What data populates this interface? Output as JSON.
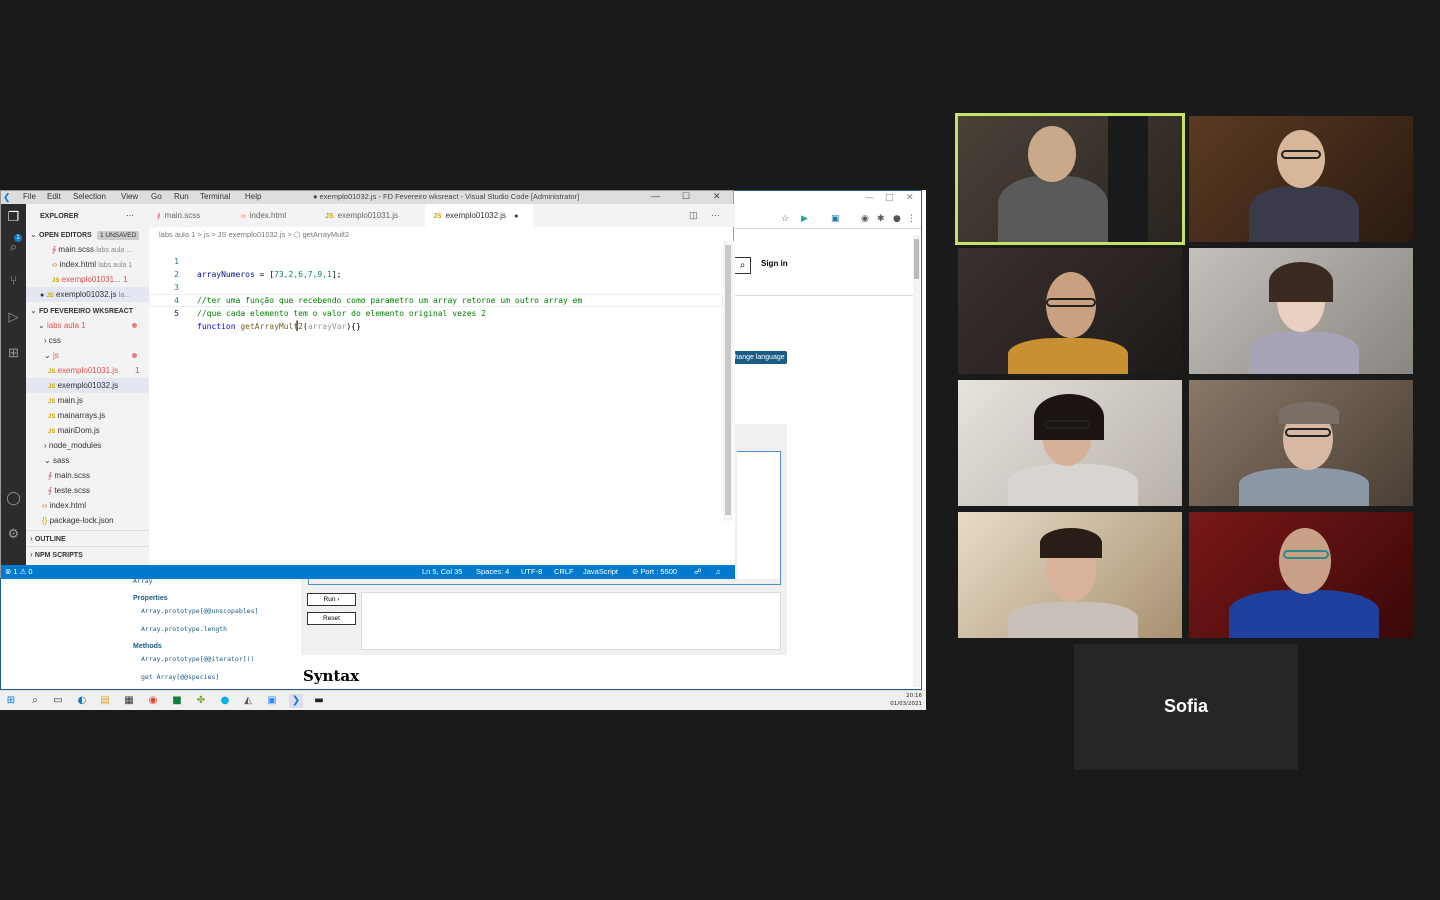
{
  "browser": {
    "signin": "Sign in",
    "change_language": "Change language",
    "sidebar": {
      "array": "Array",
      "properties": "Properties",
      "prop1": "Array.prototype[@@unscopables]",
      "prop2": "Array.prototype.length",
      "methods": "Methods",
      "meth1": "Array.prototype[@@iterator]()",
      "meth2": "get Array[@@species]"
    },
    "run": "Run ›",
    "reset": "Reset",
    "syntax": "Syntax"
  },
  "taskbar": {
    "time": "20:16",
    "date": "01/03/2021"
  },
  "vscode": {
    "menu": [
      "File",
      "Edit",
      "Selection",
      "View",
      "Go",
      "Run",
      "Terminal",
      "Help"
    ],
    "window_title": "● exemplo01032.js - FD Fevereiro wksreact - Visual Studio Code [Administrator]",
    "explorer": {
      "title": "EXPLORER",
      "open_editors": "OPEN EDITORS",
      "unsaved_badge": "1 UNSAVED",
      "open_files": [
        {
          "name": "main.scss",
          "hint": "labs aula ..."
        },
        {
          "name": "index.html",
          "hint": "labs aula 1"
        },
        {
          "name": "exemplo01031...",
          "hint": "1"
        },
        {
          "name": "exemplo01032.js",
          "hint": "la..."
        }
      ],
      "workspace": "FD FEVEREIRO WKSREACT",
      "tree": {
        "labs": "labs aula 1",
        "css": "css",
        "js": "js",
        "ex1": "exemplo01031.js",
        "ex1_badge": "1",
        "ex2": "exemplo01032.js",
        "mainjs": "main.js",
        "mainarrays": "mainarrays.js",
        "maindom": "mainDom.js",
        "node_modules": "node_modules",
        "sass": "sass",
        "mainscss": "main.scss",
        "teste": "teste.scss",
        "indexhtml": "index.html",
        "packagelock": "package-lock.json"
      },
      "outline": "OUTLINE",
      "npm": "NPM SCRIPTS"
    },
    "tabs": [
      {
        "label": "main.scss",
        "icon": "scss-icon"
      },
      {
        "label": "index.html",
        "icon": "html-icon"
      },
      {
        "label": "exemplo01031.js",
        "icon": "js-icon"
      },
      {
        "label": "exemplo01032.js",
        "icon": "js-icon"
      }
    ],
    "breadcrumb": "labs aula 1  >  js  >  JS exemplo01032.js  >  ⬡ getArrayMult2",
    "code": {
      "l1_id": "arrayNumeros",
      "l1_rest": " = [",
      "l1_nums": "73,2,6,7,9,1",
      "l1_end": "];",
      "l3": "//ter uma função que recebendo como parametro um array retorne um outro array em",
      "l4": "//que cada elemento tem o valor do elemento original vezes 2",
      "l5_kw": "function",
      "l5_fn": "getArrayMult2",
      "l5_open": "(",
      "l5_param": "arrayVar",
      "l5_close": "){}"
    },
    "line_numbers": [
      "1",
      "2",
      "3",
      "4",
      "5"
    ],
    "status": {
      "problems": "⊗ 1 ⚠ 0",
      "position": "Ln 5, Col 35",
      "spaces": "Spaces: 4",
      "encoding": "UTF-8",
      "eol": "CRLF",
      "language": "JavaScript",
      "port": "⊘ Port : 5500"
    }
  },
  "meeting": {
    "participant_name": "Sofia",
    "speaking_color": "#c5e368"
  }
}
